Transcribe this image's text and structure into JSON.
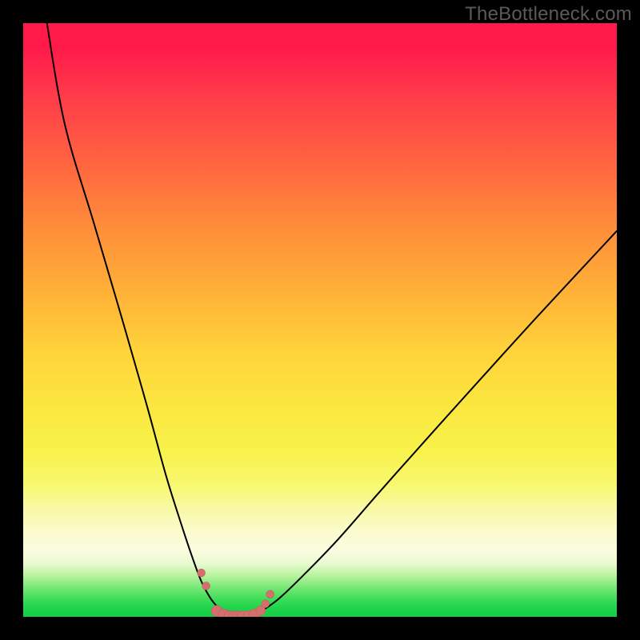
{
  "watermark": "TheBottleneck.com",
  "colors": {
    "frame": "#000000",
    "curve": "#000000",
    "markers_fill": "#d46f6d",
    "markers_stroke": "#b85a58",
    "gradient_top": "#ff1a4a",
    "gradient_bottom": "#14cf47"
  },
  "chart_data": {
    "type": "line",
    "title": "",
    "xlabel": "",
    "ylabel": "",
    "xlim": [
      0,
      100
    ],
    "ylim": [
      0,
      100
    ],
    "grid": false,
    "legend": false,
    "series": [
      {
        "name": "left-curve",
        "x": [
          4,
          7,
          12,
          17,
          21,
          24,
          26.5,
          28.5,
          30,
          31.5,
          32.8,
          33.8,
          34.5,
          35
        ],
        "y": [
          100,
          83,
          66,
          49,
          35,
          24,
          16,
          10,
          6,
          3.2,
          1.6,
          0.7,
          0.2,
          0
        ]
      },
      {
        "name": "right-curve",
        "x": [
          38,
          40,
          43,
          47,
          53,
          60,
          68,
          77,
          87,
          100
        ],
        "y": [
          0,
          0.9,
          3,
          6.8,
          13,
          21,
          30,
          40,
          51,
          65
        ]
      },
      {
        "name": "valley-markers",
        "x": [
          30.0,
          30.8,
          32.6,
          33.8,
          34.8,
          35.6,
          36.2,
          37.0,
          38.0,
          39.0,
          40.0,
          40.8,
          41.6
        ],
        "y": [
          7.4,
          5.2,
          1.0,
          0.35,
          0.1,
          0.05,
          0.05,
          0.05,
          0.1,
          0.4,
          1.05,
          2.2,
          3.8
        ],
        "marker_radius": [
          5,
          5,
          7,
          7,
          7,
          7,
          7,
          7,
          7,
          7,
          6,
          5,
          5
        ]
      }
    ]
  }
}
